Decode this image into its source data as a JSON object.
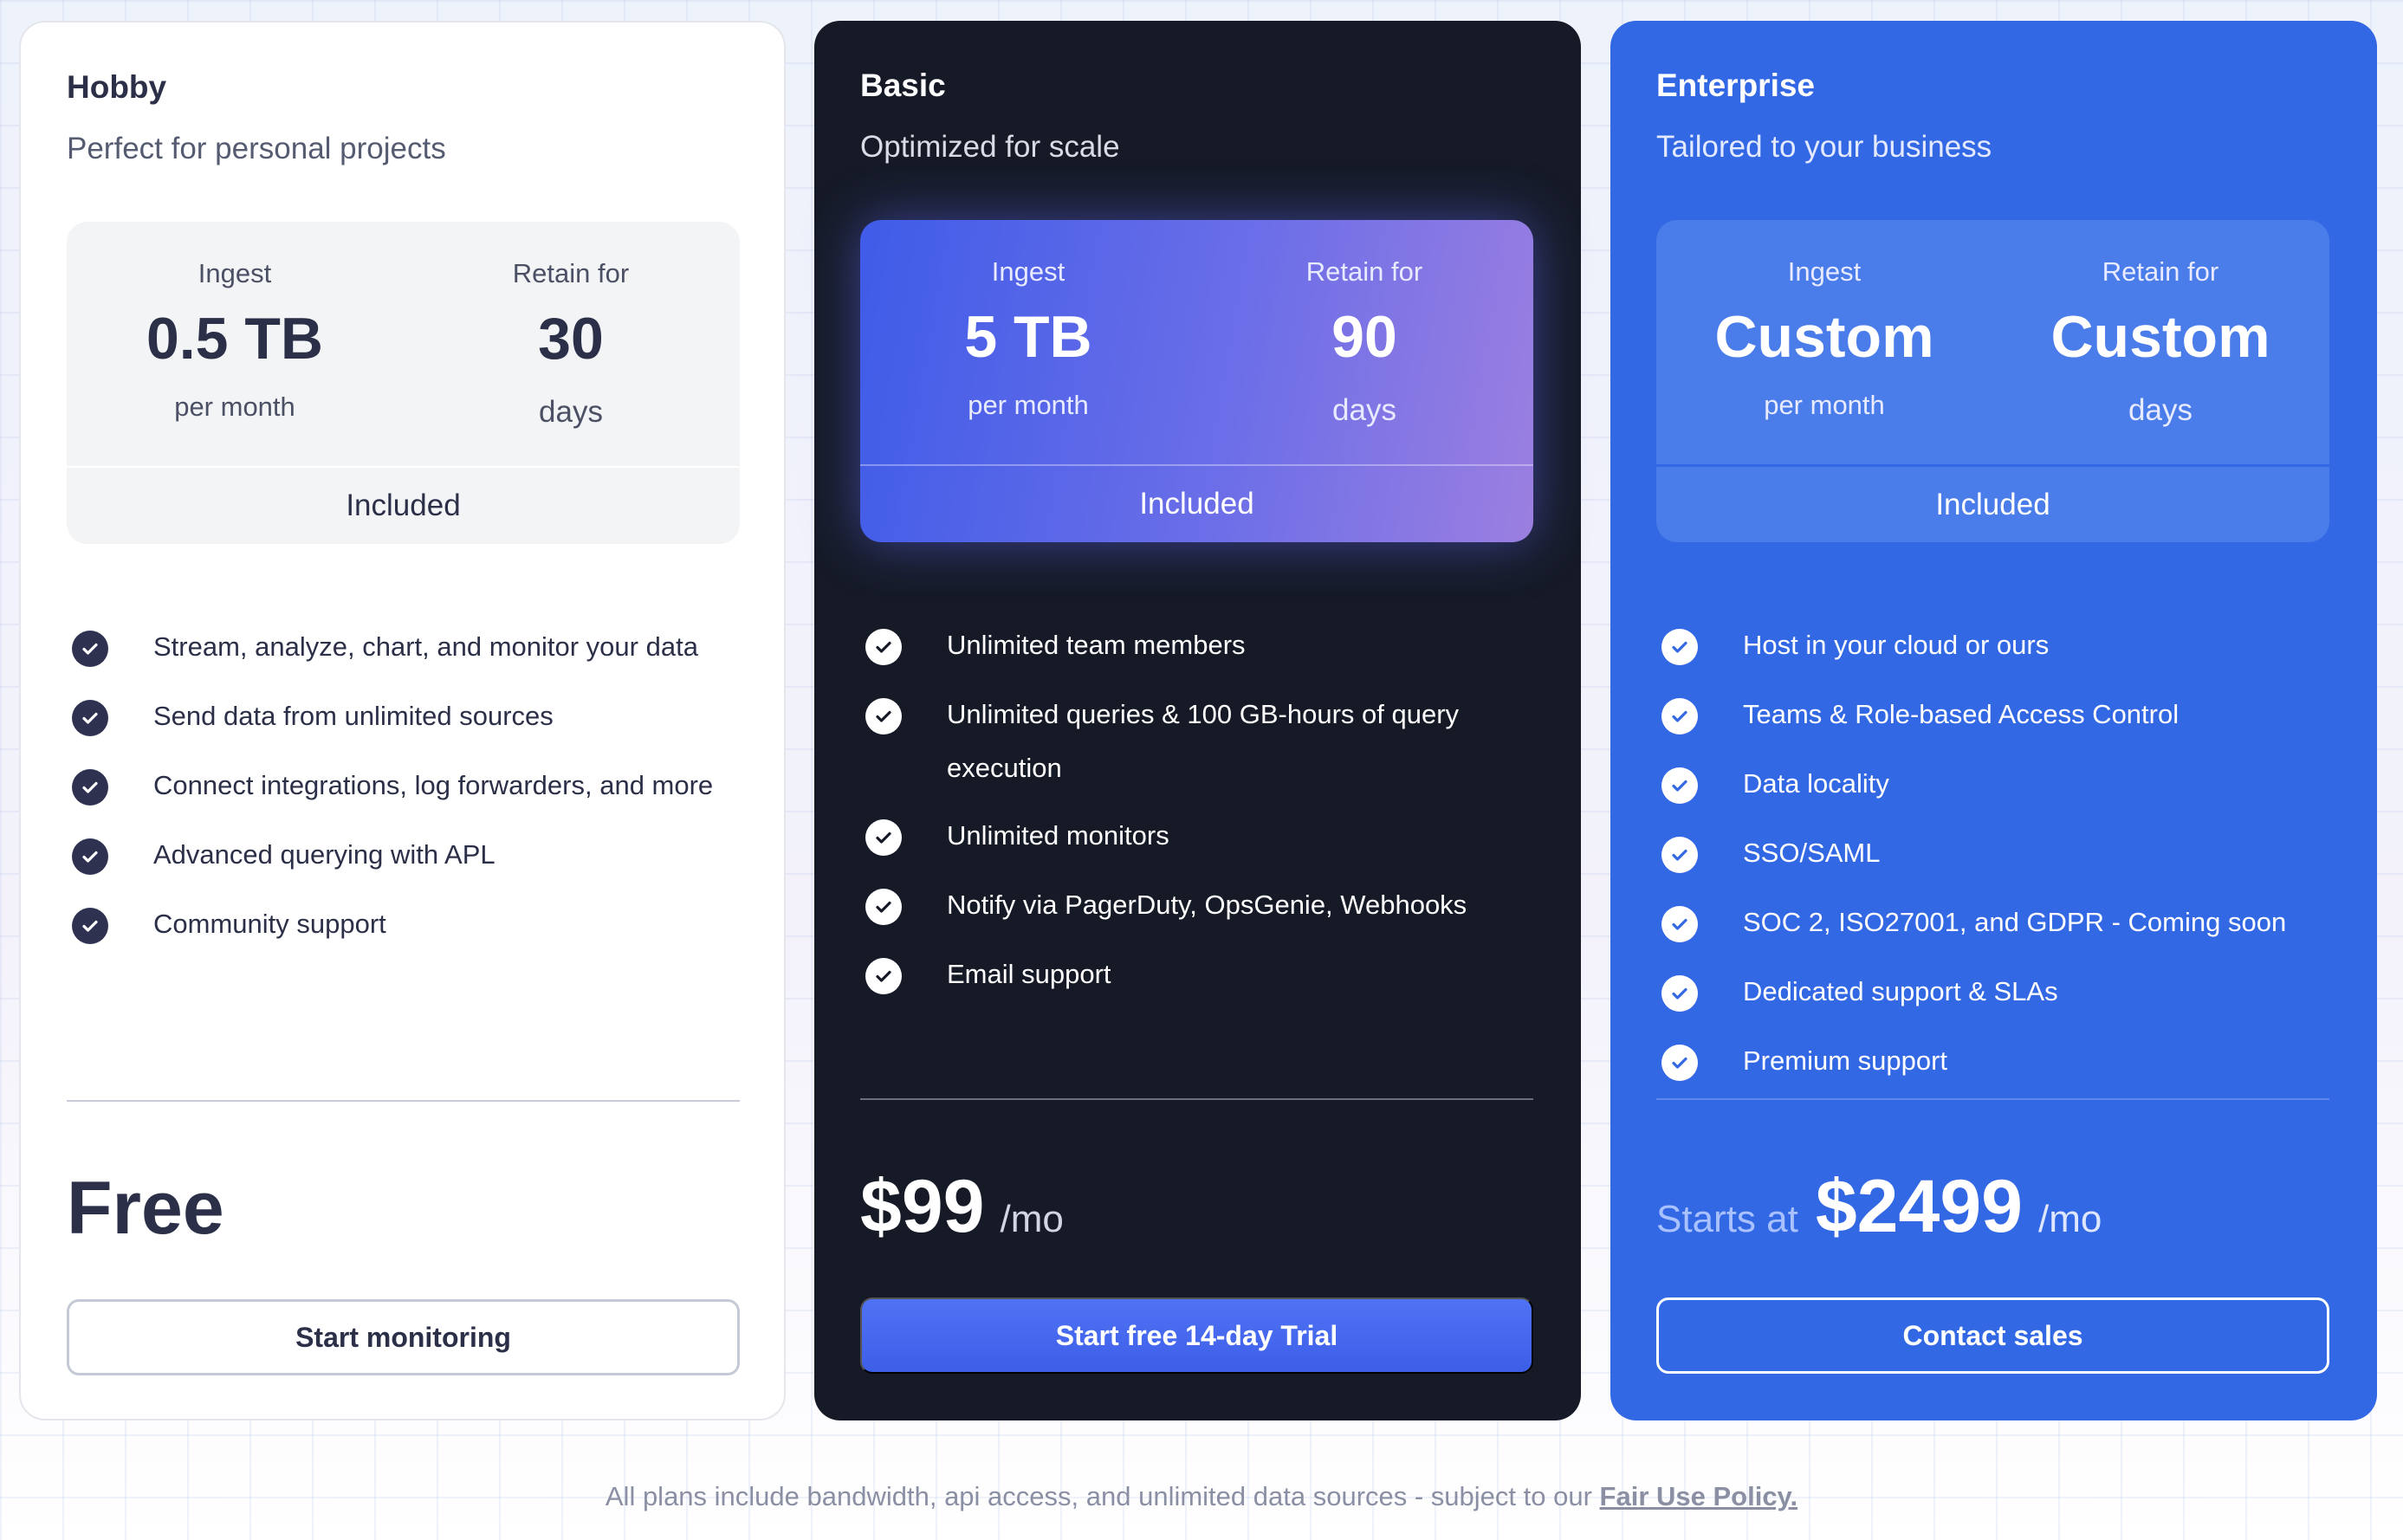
{
  "plans": [
    {
      "name": "Hobby",
      "tagline": "Perfect for personal projects",
      "ingest": {
        "label": "Ingest",
        "value": "0.5 TB",
        "unit": "per month"
      },
      "retain": {
        "label": "Retain for",
        "value": "30",
        "unit": "days"
      },
      "quota_footer": "Included",
      "features": [
        "Stream, analyze, chart, and monitor your data",
        "Send data from unlimited sources",
        "Connect integrations, log forwarders, and more",
        "Advanced querying with APL",
        "Community support"
      ],
      "price_prefix": "",
      "price": "Free",
      "price_suffix": "",
      "cta": "Start monitoring"
    },
    {
      "name": "Basic",
      "tagline": "Optimized for scale",
      "ingest": {
        "label": "Ingest",
        "value": "5 TB",
        "unit": "per month"
      },
      "retain": {
        "label": "Retain for",
        "value": "90",
        "unit": "days"
      },
      "quota_footer": "Included",
      "features": [
        "Unlimited team members",
        "Unlimited queries & 100 GB-hours of query execution",
        "Unlimited monitors",
        "Notify via PagerDuty, OpsGenie, Webhooks",
        "Email support"
      ],
      "price_prefix": "",
      "price": "$99",
      "price_suffix": "/mo",
      "cta": "Start free 14-day Trial"
    },
    {
      "name": "Enterprise",
      "tagline": "Tailored to your business",
      "ingest": {
        "label": "Ingest",
        "value": "Custom",
        "unit": "per month"
      },
      "retain": {
        "label": "Retain for",
        "value": "Custom",
        "unit": "days"
      },
      "quota_footer": "Included",
      "features": [
        "Host in your cloud or ours",
        "Teams & Role-based Access Control",
        "Data locality",
        "SSO/SAML",
        "SOC 2, ISO27001, and GDPR - Coming soon",
        "Dedicated support & SLAs",
        "Premium support"
      ],
      "price_prefix": "Starts at",
      "price": "$2499",
      "price_suffix": "/mo",
      "cta": "Contact sales"
    }
  ],
  "icons": {
    "feature_check": "check-circle-icon"
  },
  "colors": {
    "hobby_bg": "#ffffff",
    "basic_bg": "#161a27",
    "enterprise_bg": "#3368e4",
    "basic_cta": "#4566ee"
  },
  "footnote": {
    "text": "All plans include bandwidth, api access, and unlimited data sources - subject to our ",
    "link": "Fair Use Policy."
  }
}
